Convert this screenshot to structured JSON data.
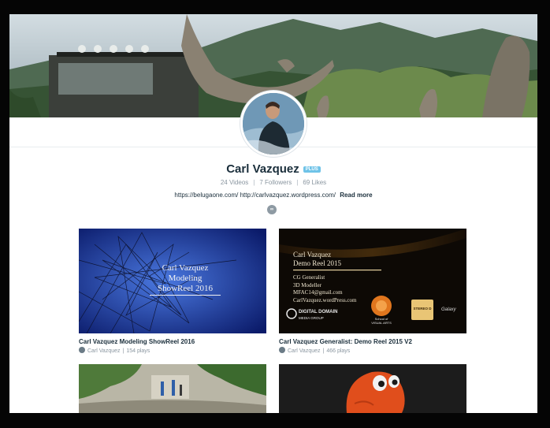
{
  "profile": {
    "name": "Carl Vazquez",
    "badge": "PLUS",
    "stats": {
      "videos": "24 Videos",
      "followers": "7 Followers",
      "likes": "69 Likes",
      "separator": "|"
    },
    "links_text": "https://belugaone.com/ http://carlvazquez.wordpress.com/",
    "read_more": "Read more",
    "social_icon": "link-icon"
  },
  "videos": [
    {
      "title": "Carl Vazquez Modeling ShowReel 2016",
      "owner": "Carl Vazquez",
      "separator": "|",
      "plays": "154 plays",
      "thumb_lines": [
        "Carl Vazquez",
        "Modeling",
        "ShowReel 2016"
      ]
    },
    {
      "title": "Carl Vazquez Generalist: Demo Reel 2015 V2",
      "owner": "Carl Vazquez",
      "separator": "|",
      "plays": "466 plays",
      "thumb_heading": [
        "Carl Vazquez",
        "Demo Reel 2015"
      ],
      "thumb_lines": [
        "CG Generalist",
        "3D Modeller",
        "MFAC14@gmail.com",
        "CarlVazquez.wordPress.com"
      ],
      "logos": {
        "digital_domain": "DIGITAL DOMAIN",
        "digital_domain_sub": "MEDIA GROUP",
        "school": "School of",
        "school_sub": "VISUAL ARTS",
        "stereo": "STEREO D",
        "galaxy": "Galaxy"
      }
    },
    {
      "title": "",
      "owner": "",
      "plays": ""
    },
    {
      "title": "",
      "owner": "",
      "plays": ""
    }
  ],
  "colors": {
    "accent": "#6fc3e8",
    "title": "#1a2e3b",
    "meta": "#8a96a0"
  }
}
